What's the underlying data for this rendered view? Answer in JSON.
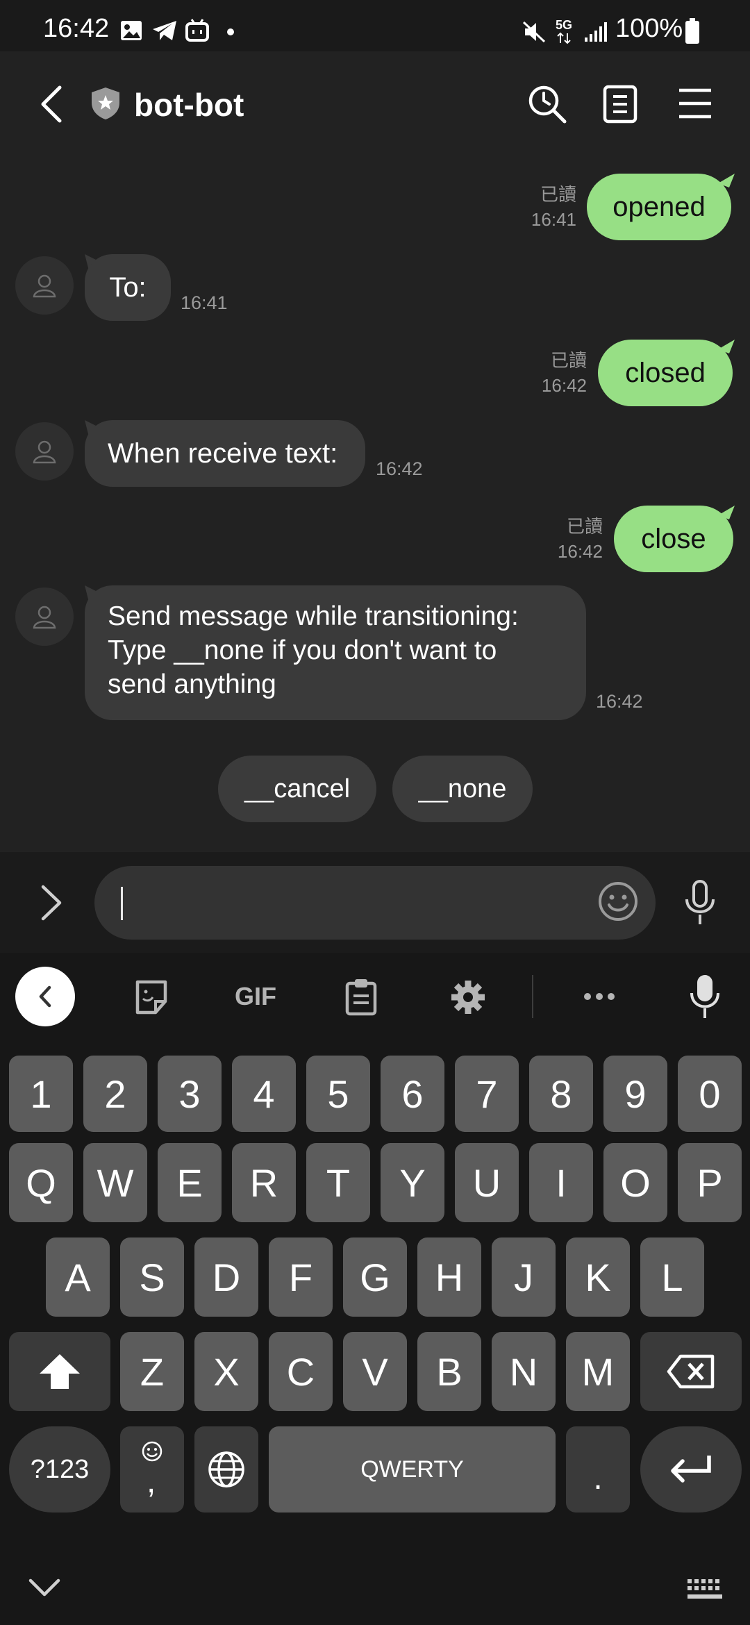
{
  "status_bar": {
    "time": "16:42",
    "battery": "100%",
    "network": "5G"
  },
  "header": {
    "title": "bot-bot"
  },
  "messages": {
    "m1": {
      "text": "opened",
      "read": "已讀",
      "time": "16:41"
    },
    "m2": {
      "text": "To:",
      "time": "16:41"
    },
    "m3": {
      "text": "closed",
      "read": "已讀",
      "time": "16:42"
    },
    "m4": {
      "text": "When receive text:",
      "time": "16:42"
    },
    "m5": {
      "text": "close",
      "read": "已讀",
      "time": "16:42"
    },
    "m6": {
      "line1": "Send message while transitioning:",
      "line2": "Type __none if you don't want to",
      "line3": "send anything",
      "time": "16:42"
    }
  },
  "quick_replies": [
    "__cancel",
    "__none"
  ],
  "composer": {
    "value": "",
    "placeholder": ""
  },
  "keyboard": {
    "toolbar_gif": "GIF",
    "row_numbers": [
      "1",
      "2",
      "3",
      "4",
      "5",
      "6",
      "7",
      "8",
      "9",
      "0"
    ],
    "row_top": [
      "Q",
      "W",
      "E",
      "R",
      "T",
      "Y",
      "U",
      "I",
      "O",
      "P"
    ],
    "row_mid": [
      "A",
      "S",
      "D",
      "F",
      "G",
      "H",
      "J",
      "K",
      "L"
    ],
    "row_bottom": [
      "Z",
      "X",
      "C",
      "V",
      "B",
      "N",
      "M"
    ],
    "symbols": "?123",
    "comma": ",",
    "space": "QWERTY",
    "period": "."
  },
  "colors": {
    "outgoing_bubble": "#97df85",
    "incoming_bubble": "#3a3a3a",
    "background": "#222222"
  }
}
